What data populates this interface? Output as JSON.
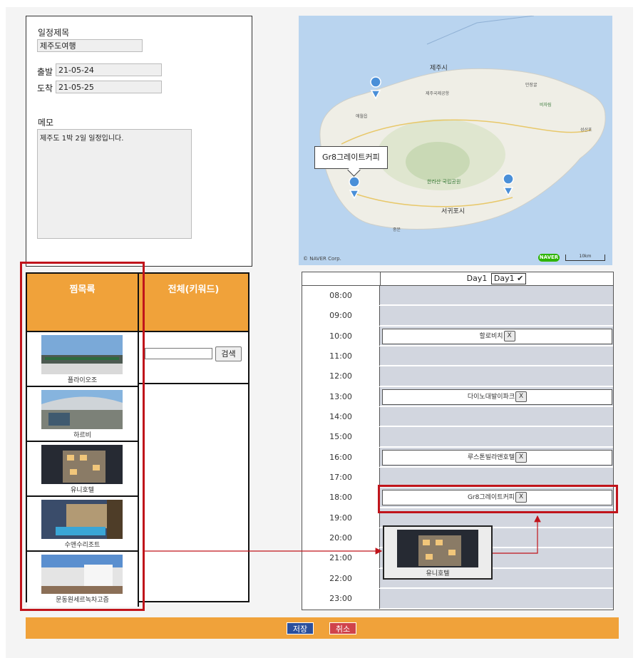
{
  "trip": {
    "title_label": "일정제목",
    "title_value": "제주도여행",
    "depart_label": "출발",
    "depart_value": "21-05-24",
    "arrive_label": "도착",
    "arrive_value": "21-05-25",
    "memo_label": "메모",
    "memo_value": "제주도 1박 2일 일정입니다."
  },
  "map": {
    "callout": "Gr8그레이트커피",
    "copyright": "© NAVER Corp.",
    "logo": "NAVER",
    "scale": "10km",
    "labels": [
      "제주시",
      "서귀포시",
      "한라산 국립공원",
      "애월읍",
      "성산포",
      "비자림",
      "만장굴",
      "제주국제공항",
      "중문"
    ]
  },
  "panel": {
    "fav_tab": "찜목록",
    "all_tab": "전체(키워드)",
    "search_button": "검색",
    "search_value": "",
    "favorites": [
      {
        "name": "플라이오조"
      },
      {
        "name": "하르비"
      },
      {
        "name": "유니호텔"
      },
      {
        "name": "수앤수리조트"
      },
      {
        "name": "문동원세르녹차고즘"
      }
    ]
  },
  "schedule": {
    "day_label": "Day1",
    "day_select": "Day1",
    "times": [
      "08:00",
      "09:00",
      "10:00",
      "11:00",
      "12:00",
      "13:00",
      "14:00",
      "15:00",
      "16:00",
      "17:00",
      "18:00",
      "19:00",
      "20:00",
      "21:00",
      "22:00",
      "23:00"
    ],
    "events": {
      "10:00": "할로비치",
      "13:00": "다이노대발이파크",
      "16:00": "루스톤빌라앤호텔",
      "18:00": "Gr8그레이트커피"
    },
    "remove_label": "X"
  },
  "drag": {
    "name": "유니호텔"
  },
  "actions": {
    "save": "저장",
    "cancel": "취소"
  },
  "colors": {
    "accent": "#f0a23a",
    "highlight": "#c0141b",
    "slot": "#d2d6df",
    "save": "#2b4f9c",
    "cancel": "#d0434a"
  }
}
